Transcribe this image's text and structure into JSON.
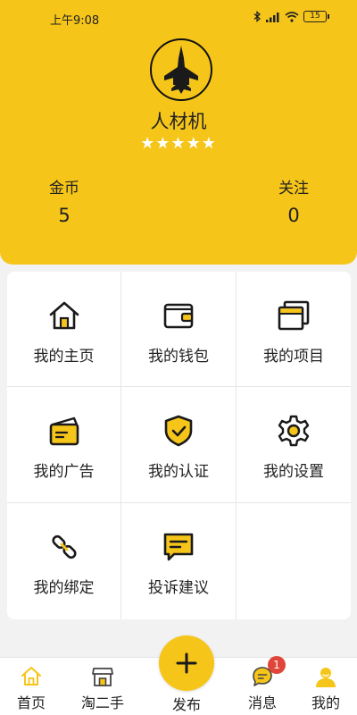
{
  "status_bar": {
    "time": "上午9:08",
    "battery": "15"
  },
  "profile": {
    "name": "人材机",
    "stars": "★★★★★",
    "stats": [
      {
        "label": "金币",
        "value": "5"
      },
      {
        "label": "关注",
        "value": "0"
      }
    ]
  },
  "menu": [
    {
      "label": "我的主页",
      "icon": "home-icon"
    },
    {
      "label": "我的钱包",
      "icon": "wallet-icon"
    },
    {
      "label": "我的项目",
      "icon": "projects-icon"
    },
    {
      "label": "我的广告",
      "icon": "ad-card-icon"
    },
    {
      "label": "我的认证",
      "icon": "shield-check-icon"
    },
    {
      "label": "我的设置",
      "icon": "gear-icon"
    },
    {
      "label": "我的绑定",
      "icon": "link-icon"
    },
    {
      "label": "投诉建议",
      "icon": "feedback-icon"
    }
  ],
  "tabbar": {
    "home": "首页",
    "second_hand": "淘二手",
    "publish": "发布",
    "messages": "消息",
    "mine": "我的",
    "message_badge": "1"
  },
  "colors": {
    "accent": "#f6c51a",
    "badge": "#e0453a",
    "background": "#f2f2f2"
  }
}
